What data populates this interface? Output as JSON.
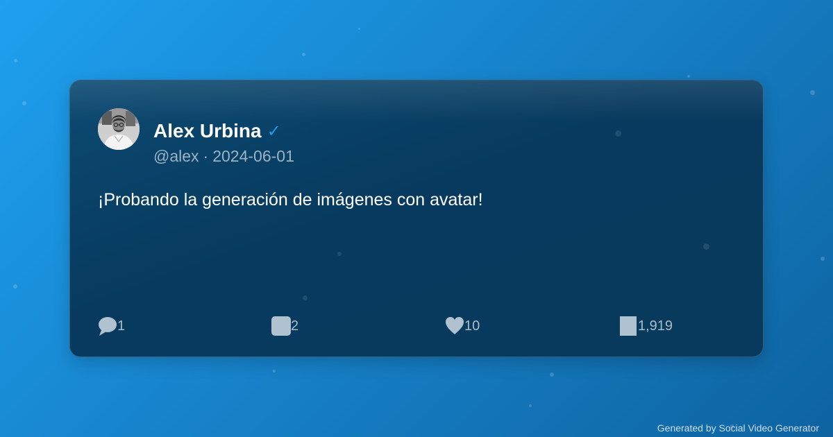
{
  "tweet": {
    "author_name": "Alex Urbina",
    "verified_mark": "✓",
    "handle": "@alex",
    "separator": "·",
    "date": "2024-06-01",
    "text": "¡Probando la generación de imágenes con avatar!"
  },
  "stats": {
    "replies": "1",
    "retweets": "2",
    "likes": "10",
    "views": "1,919"
  },
  "icons": {
    "reply": "reply-icon",
    "retweet": "retweet-icon",
    "like": "heart-icon",
    "views": "views-icon",
    "verified": "verified-badge-icon"
  },
  "colors": {
    "background_start": "#1ea0ef",
    "background_end": "#0e63a0",
    "card_background": "#073a5e",
    "verified": "#1d9bf0",
    "meta_text": "#9ab3c6",
    "stat_icon": "#b0c2cf"
  },
  "footer": {
    "credit": "Generated by Social Video Generator"
  }
}
